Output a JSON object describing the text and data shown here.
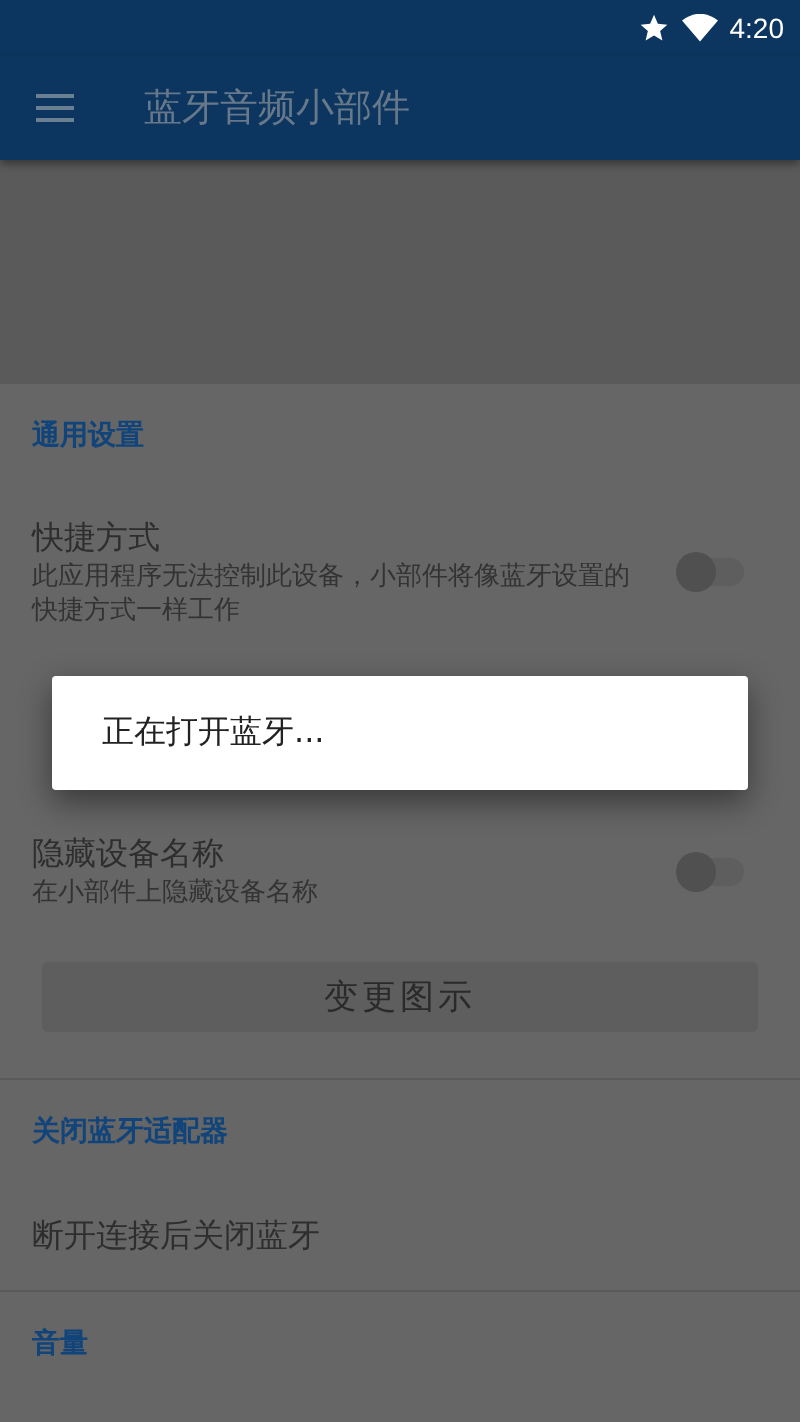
{
  "status_bar": {
    "time": "4:20"
  },
  "app_bar": {
    "title": "蓝牙音频小部件"
  },
  "sections": [
    {
      "header": "通用设置",
      "items": [
        {
          "kind": "switch",
          "title": "快捷方式",
          "subtitle": "此应用程序无法控制此设备，小部件将像蓝牙设置的快捷方式一样工作",
          "on": false
        },
        {
          "kind": "covered"
        },
        {
          "kind": "switch",
          "title": "隐藏设备名称",
          "subtitle": "在小部件上隐藏设备名称",
          "on": false
        },
        {
          "kind": "button",
          "label": "变更图示"
        }
      ]
    },
    {
      "header": "关闭蓝牙适配器",
      "items": [
        {
          "kind": "text",
          "title": "断开连接后关闭蓝牙"
        }
      ]
    },
    {
      "header": "音量"
    }
  ],
  "dialog": {
    "message": "正在打开蓝牙..."
  }
}
